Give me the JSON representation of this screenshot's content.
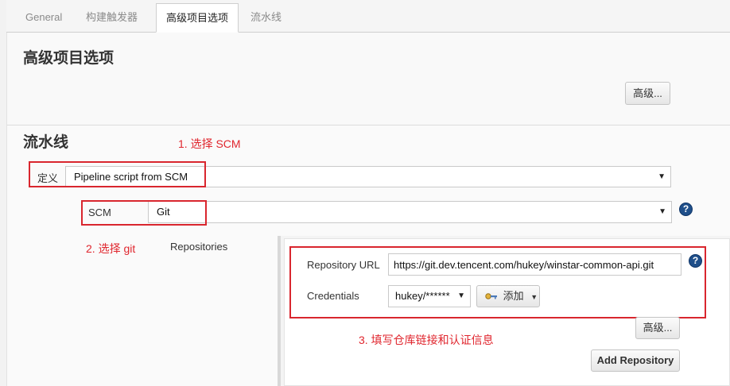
{
  "tabs": [
    {
      "label": "General"
    },
    {
      "label": "构建触发器"
    },
    {
      "label": "高级项目选项"
    },
    {
      "label": "流水线"
    }
  ],
  "advanced_section": {
    "title": "高级项目选项",
    "advanced_button": "高级..."
  },
  "pipeline_section": {
    "title": "流水线",
    "definition_label": "定义",
    "definition_value": "Pipeline script from SCM",
    "scm_label": "SCM",
    "scm_value": "Git",
    "repositories_label": "Repositories",
    "repository_url_label": "Repository URL",
    "repository_url_value": "https://git.dev.tencent.com/hukey/winstar-common-api.git",
    "credentials_label": "Credentials",
    "credentials_value": "hukey/******",
    "add_button": "添加",
    "repo_advanced_button": "高级...",
    "add_repository_button": "Add Repository",
    "help_glyph": "?"
  },
  "annotations": {
    "step1": "1. 选择 SCM",
    "step2": "2. 选择 git",
    "step3": "3. 填写仓库链接和认证信息"
  },
  "colors": {
    "annotation_red": "#d9262e",
    "help_blue": "#1f4f8a"
  }
}
